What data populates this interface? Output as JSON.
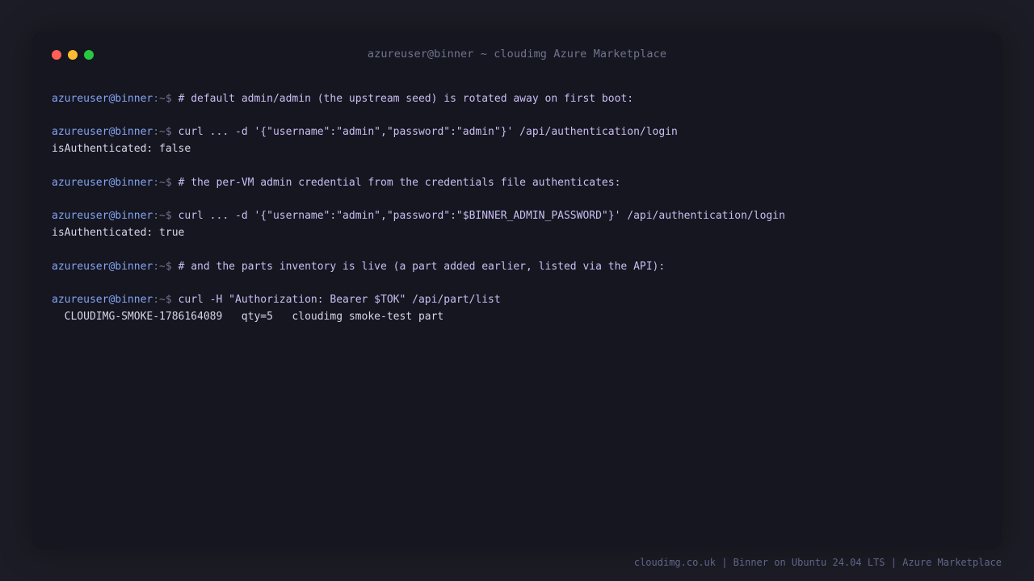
{
  "window": {
    "title": "azureuser@binner ~ cloudimg Azure Marketplace",
    "traffic_lights": [
      {
        "name": "close",
        "color": "#ff5f57"
      },
      {
        "name": "minimize",
        "color": "#febc2e"
      },
      {
        "name": "maximize",
        "color": "#28c840"
      }
    ]
  },
  "prompt": {
    "user_host": "azureuser@binner",
    "path_symbol": ":~$"
  },
  "lines": {
    "l1": "# default admin/admin (the upstream seed) is rotated away on first boot:",
    "l2": "curl ... -d '{\"username\":\"admin\",\"password\":\"admin\"}' /api/authentication/login",
    "l2_out": "isAuthenticated: false",
    "l3": "# the per-VM admin credential from the credentials file authenticates:",
    "l4": "curl ... -d '{\"username\":\"admin\",\"password\":\"$BINNER_ADMIN_PASSWORD\"}' /api/authentication/login",
    "l4_out": "isAuthenticated: true",
    "l5": "# and the parts inventory is live (a part added earlier, listed via the API):",
    "l6": "curl -H \"Authorization: Bearer $TOK\" /api/part/list",
    "l6_out": "  CLOUDIMG-SMOKE-1786164089   qty=5   cloudimg smoke-test part"
  },
  "footer": {
    "text": "cloudimg.co.uk | Binner on Ubuntu 24.04 LTS | Azure Marketplace"
  },
  "colors": {
    "background": "#1c1c26",
    "terminal_bg": "#161620",
    "prompt_user": "#83a4f4",
    "command_text": "#c9bdf2"
  }
}
